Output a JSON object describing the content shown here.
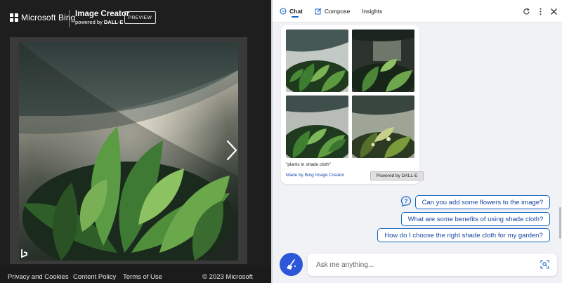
{
  "header": {
    "brand": "Microsoft Bing",
    "product_title": "Image Creator",
    "powered_prefix": "powered by ",
    "powered_model": "DALL·E",
    "preview_label": "PREVIEW"
  },
  "footer": {
    "privacy": "Privacy and Cookies",
    "content_policy": "Content Policy",
    "terms": "Terms of Use",
    "copyright": "© 2023 Microsoft"
  },
  "sidebar": {
    "tabs": [
      {
        "label": "Chat",
        "icon": "chat-icon",
        "active": true
      },
      {
        "label": "Compose",
        "icon": "compose-icon",
        "active": false
      },
      {
        "label": "Insights",
        "icon": "",
        "active": false
      }
    ],
    "gallery": {
      "prompt": "\"plants in shade cloth\"",
      "made_by": "Made by Bing Image Creator",
      "powered_by": "Powered by DALL-E"
    },
    "suggestions": [
      "Can you add some flowers to the image?",
      "What are some benefits of using shade cloth?",
      "How do I choose the right shade cloth for my garden?"
    ],
    "input": {
      "placeholder": "Ask me anything..."
    }
  },
  "colors": {
    "accent": "#1565c0",
    "new_topic": "#2b57d8",
    "link": "#1a4fb0"
  }
}
